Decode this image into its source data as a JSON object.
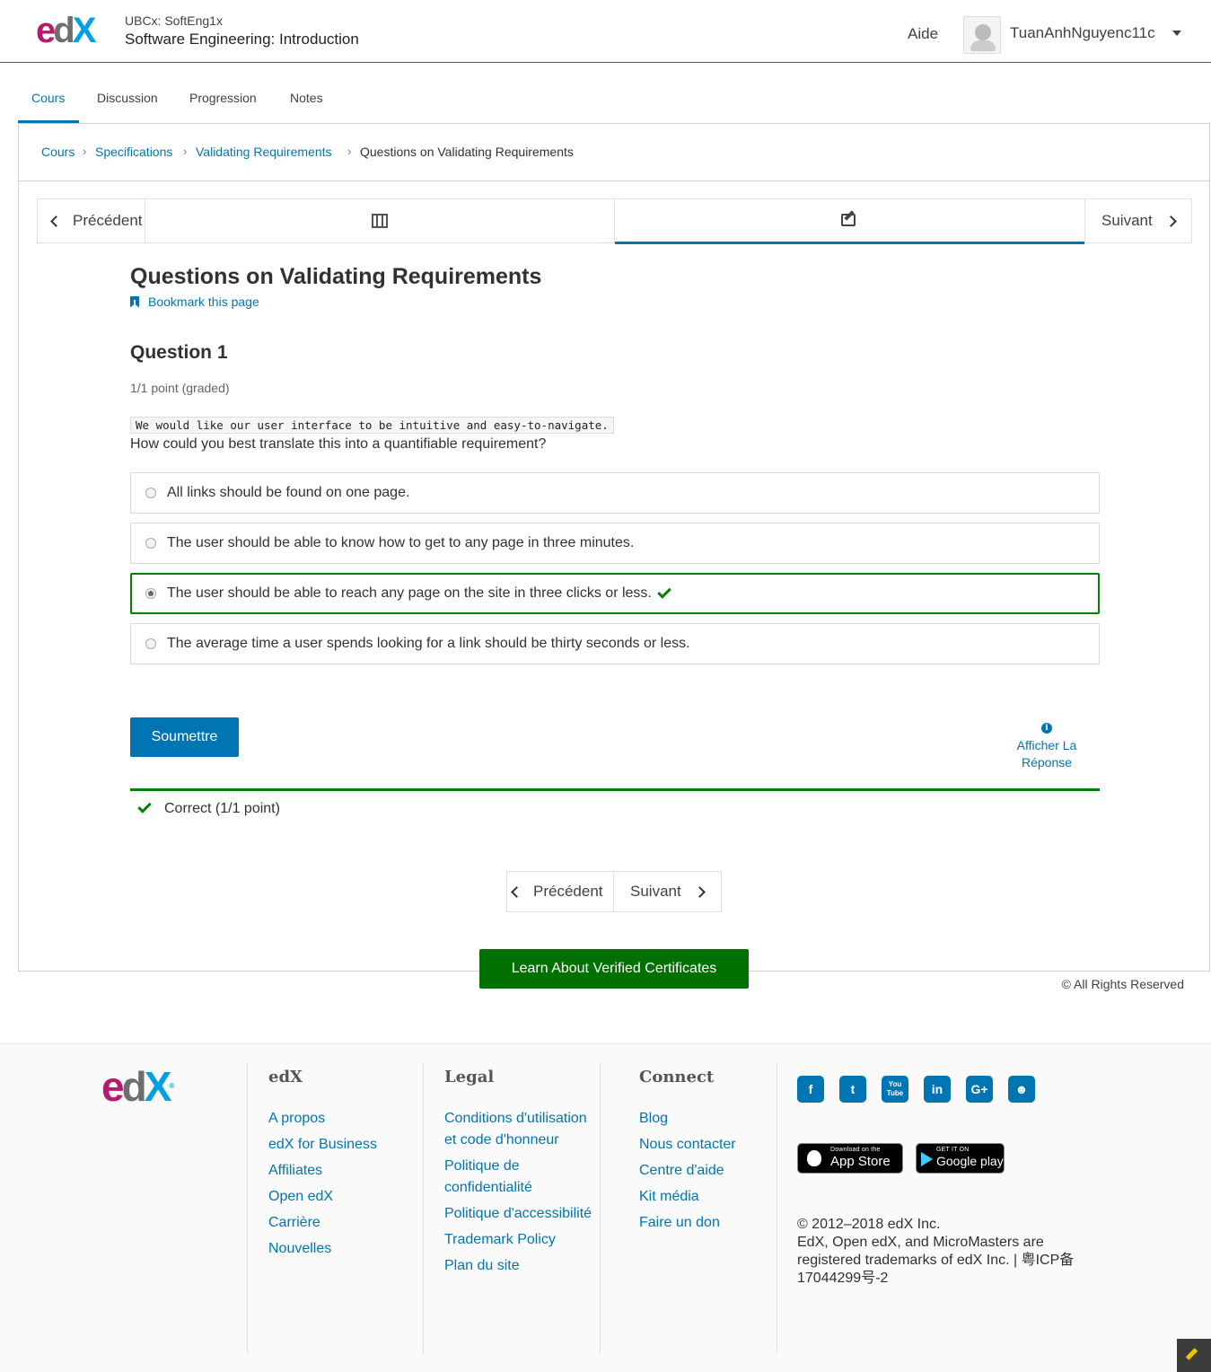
{
  "header": {
    "logo_text": "edX",
    "course_org": "UBCx: SoftEng1x",
    "course_name": "Software Engineering: Introduction",
    "help": "Aide",
    "username": "TuanAnhNguyenc11c"
  },
  "tabs": [
    {
      "label": "Cours",
      "active": true
    },
    {
      "label": "Discussion",
      "active": false
    },
    {
      "label": "Progression",
      "active": false
    },
    {
      "label": "Notes",
      "active": false
    }
  ],
  "breadcrumb": [
    "Cours",
    "Specifications",
    "Validating Requirements",
    "Questions on Validating Requirements"
  ],
  "sequence": {
    "prev_label": "Précédent",
    "next_label": "Suivant",
    "units": [
      {
        "icon": "video-icon",
        "active": false
      },
      {
        "icon": "problem-edit-icon",
        "active": true
      }
    ]
  },
  "unit": {
    "title": "Questions on Validating Requirements",
    "bookmark": "Bookmark this page"
  },
  "problem": {
    "title": "Question 1",
    "points": "1/1 point (graded)",
    "code": "We would like our user interface to be intuitive and easy-to-navigate.",
    "question": "How could you best translate this into a quantifiable requirement?",
    "choices": [
      {
        "label": "All links should be found on one page.",
        "selected": false
      },
      {
        "label": "The user should be able to know how to get to any page in three minutes.",
        "selected": false
      },
      {
        "label": "The user should be able to reach any page on the site in three clicks or less.",
        "selected": true,
        "correct": true
      },
      {
        "label": "The average time a user spends looking for a link should be thirty seconds or less.",
        "selected": false
      }
    ],
    "submit": "Soumettre",
    "show_answer": "Afficher La Réponse",
    "result": "Correct (1/1 point)",
    "correct_color": "#008100"
  },
  "bottom_nav": {
    "prev_label": "Précédent",
    "next_label": "Suivant"
  },
  "cert_button": "Learn About Verified Certificates",
  "rights": "© All Rights Reserved",
  "footer": {
    "logo_text": "edX",
    "logo_mark": "®",
    "col_edx": {
      "title": "edX",
      "links": [
        "A propos",
        "edX for Business",
        "Affiliates",
        "Open edX",
        "Carrière",
        "Nouvelles"
      ]
    },
    "col_legal": {
      "title": "Legal",
      "links": [
        "Conditions d'utilisation et code d'honneur",
        "Politique de confidentialité",
        "Politique d'accessibilité",
        "Trademark Policy",
        "Plan du site"
      ]
    },
    "col_connect": {
      "title": "Connect",
      "links": [
        "Blog",
        "Nous contacter",
        "Centre d'aide",
        "Kit média",
        "Faire un don"
      ]
    },
    "socials": [
      "facebook-icon",
      "twitter-icon",
      "youtube-icon",
      "linkedin-icon",
      "google-plus-icon",
      "reddit-icon"
    ],
    "social_glyphs": [
      "f",
      "t",
      "You Tube",
      "in",
      "G+",
      "☻"
    ],
    "appstore_small": "Download on the",
    "appstore_big": "App Store",
    "gplay_small": "GET IT ON",
    "gplay_big": "Google play",
    "copyright_line1": "© 2012–2018 edX Inc.",
    "copyright_line2": "EdX, Open edX, and MicroMasters are registered trademarks of edX Inc. | 粤ICP备17044299号-2"
  },
  "colors": {
    "brand_blue": "#0075b4",
    "success_green": "#008100",
    "cert_green": "#007100"
  }
}
